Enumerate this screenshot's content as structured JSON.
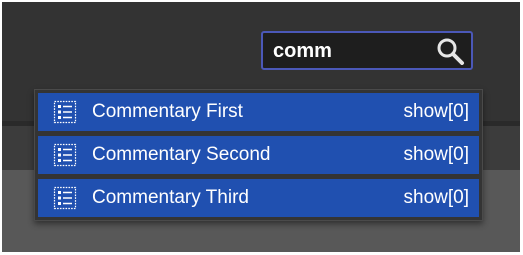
{
  "search": {
    "value": "comm",
    "icon": "search-icon"
  },
  "suggestions": [
    {
      "label": "Commentary First",
      "action": "show[0]",
      "icon": "document-list-icon"
    },
    {
      "label": "Commentary Second",
      "action": "show[0]",
      "icon": "document-list-icon"
    },
    {
      "label": "Commentary Third",
      "action": "show[0]",
      "icon": "document-list-icon"
    }
  ],
  "colors": {
    "accent_border": "#4b58b8",
    "item_background": "#2050b0",
    "background": "#333333"
  }
}
